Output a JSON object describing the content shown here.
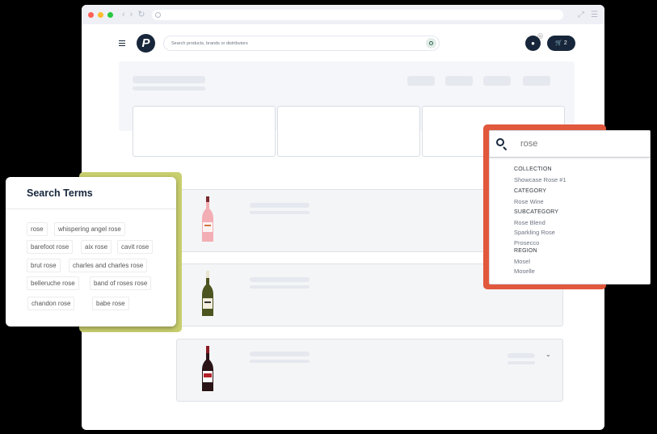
{
  "header": {
    "search_placeholder": "Search products, brands or distributors",
    "notification_count": "0",
    "cart_count": "2"
  },
  "search_terms": {
    "title": "Search Terms",
    "terms": [
      "rose",
      "whispering angel rose",
      "barefoot rose",
      "aix rose",
      "cavit rose",
      "brut rose",
      "charles and charles rose",
      "belleruche rose",
      "band of roses rose",
      "chandon rose",
      "babe rose"
    ]
  },
  "autocomplete": {
    "query": "rose",
    "groups": [
      {
        "heading": "COLLECTION",
        "items": [
          "Showcase Rose #1"
        ]
      },
      {
        "heading": "CATEGORY",
        "items": [
          "Rose Wine"
        ]
      },
      {
        "heading": "SUBCATEGORY",
        "items": [
          "Rose Blend",
          "Sparkling Rose",
          "Prosecco"
        ]
      },
      {
        "heading": "REGION",
        "items": [
          "Mosel",
          "Moselle"
        ]
      }
    ]
  },
  "colors": {
    "brand_navy": "#17263a",
    "terms_accent": "#c9cf6e",
    "autocomplete_accent": "#e2583c"
  },
  "icons": [
    "menu-icon",
    "logo-icon",
    "search-icon",
    "bell-icon",
    "cart-icon",
    "chevron-down-icon",
    "wine-bottle-icon"
  ]
}
